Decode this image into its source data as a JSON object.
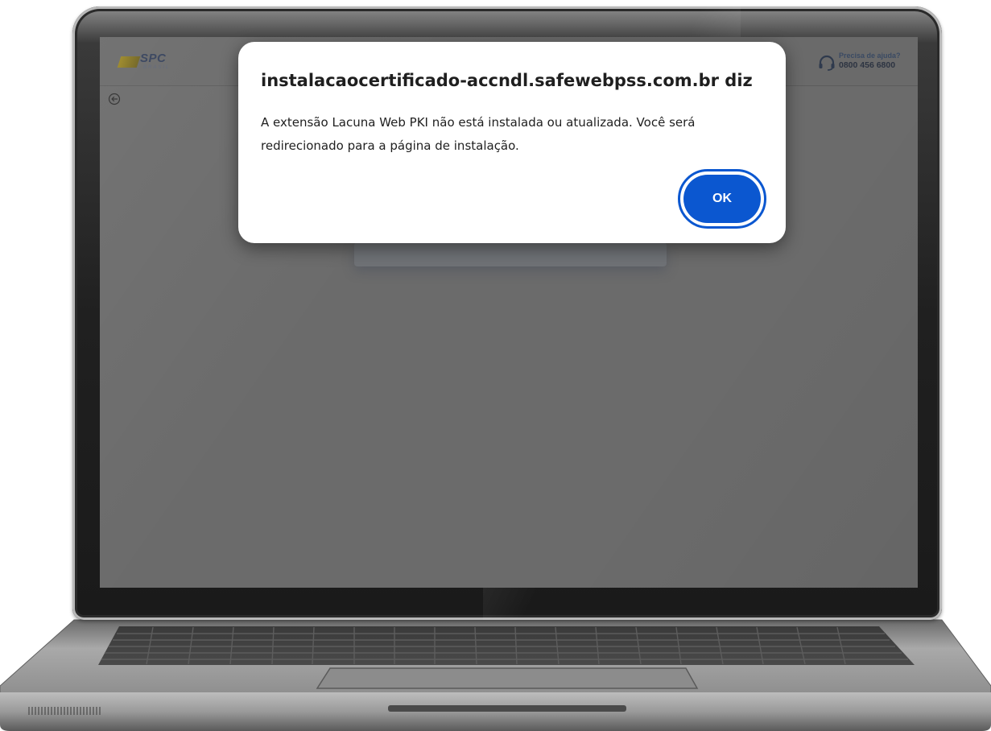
{
  "site": {
    "logo_text": "SPC",
    "logo_subtext": "BRASIL",
    "help": {
      "title": "Precisa de ajuda?",
      "phone": "0800 456 6800",
      "icon": "headset-icon"
    },
    "back_icon": "back-arrow-icon"
  },
  "dialog": {
    "title": "instalacaocertificado-accndl.safewebpss.com.br diz",
    "message": "A extensão Lacuna Web PKI não está instalada ou atualizada. Você será redirecionado para a página de instalação.",
    "ok_label": "OK"
  },
  "colors": {
    "primary_button": "#0b57d0",
    "screen_overlay": "#6b6b6b",
    "dialog_bg": "#ffffff"
  }
}
